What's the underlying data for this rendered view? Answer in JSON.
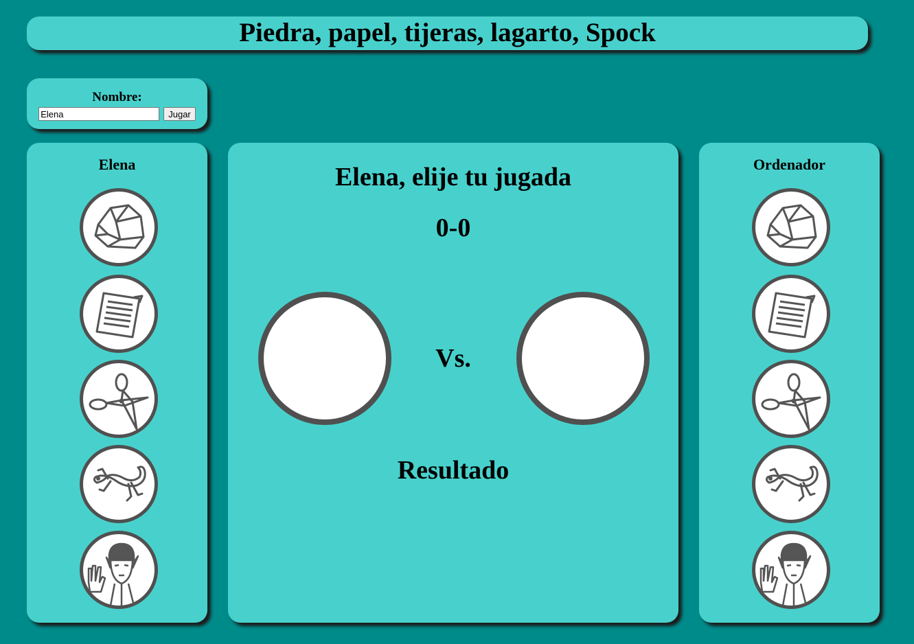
{
  "header": {
    "title": "Piedra, papel, tijeras, lagarto, Spock"
  },
  "name_form": {
    "label": "Nombre:",
    "input_value": "Elena",
    "play_label": "Jugar"
  },
  "player": {
    "title": "Elena"
  },
  "computer": {
    "title": "Ordenador"
  },
  "board": {
    "prompt": "Elena, elije tu jugada",
    "score": "0-0",
    "vs": "Vs.",
    "result": "Resultado"
  },
  "moves": [
    "rock-icon",
    "paper-icon",
    "scissors-icon",
    "lizard-icon",
    "spock-icon"
  ],
  "colors": {
    "background": "#008b8b",
    "panel": "#48d1cc",
    "ring": "#505050"
  }
}
